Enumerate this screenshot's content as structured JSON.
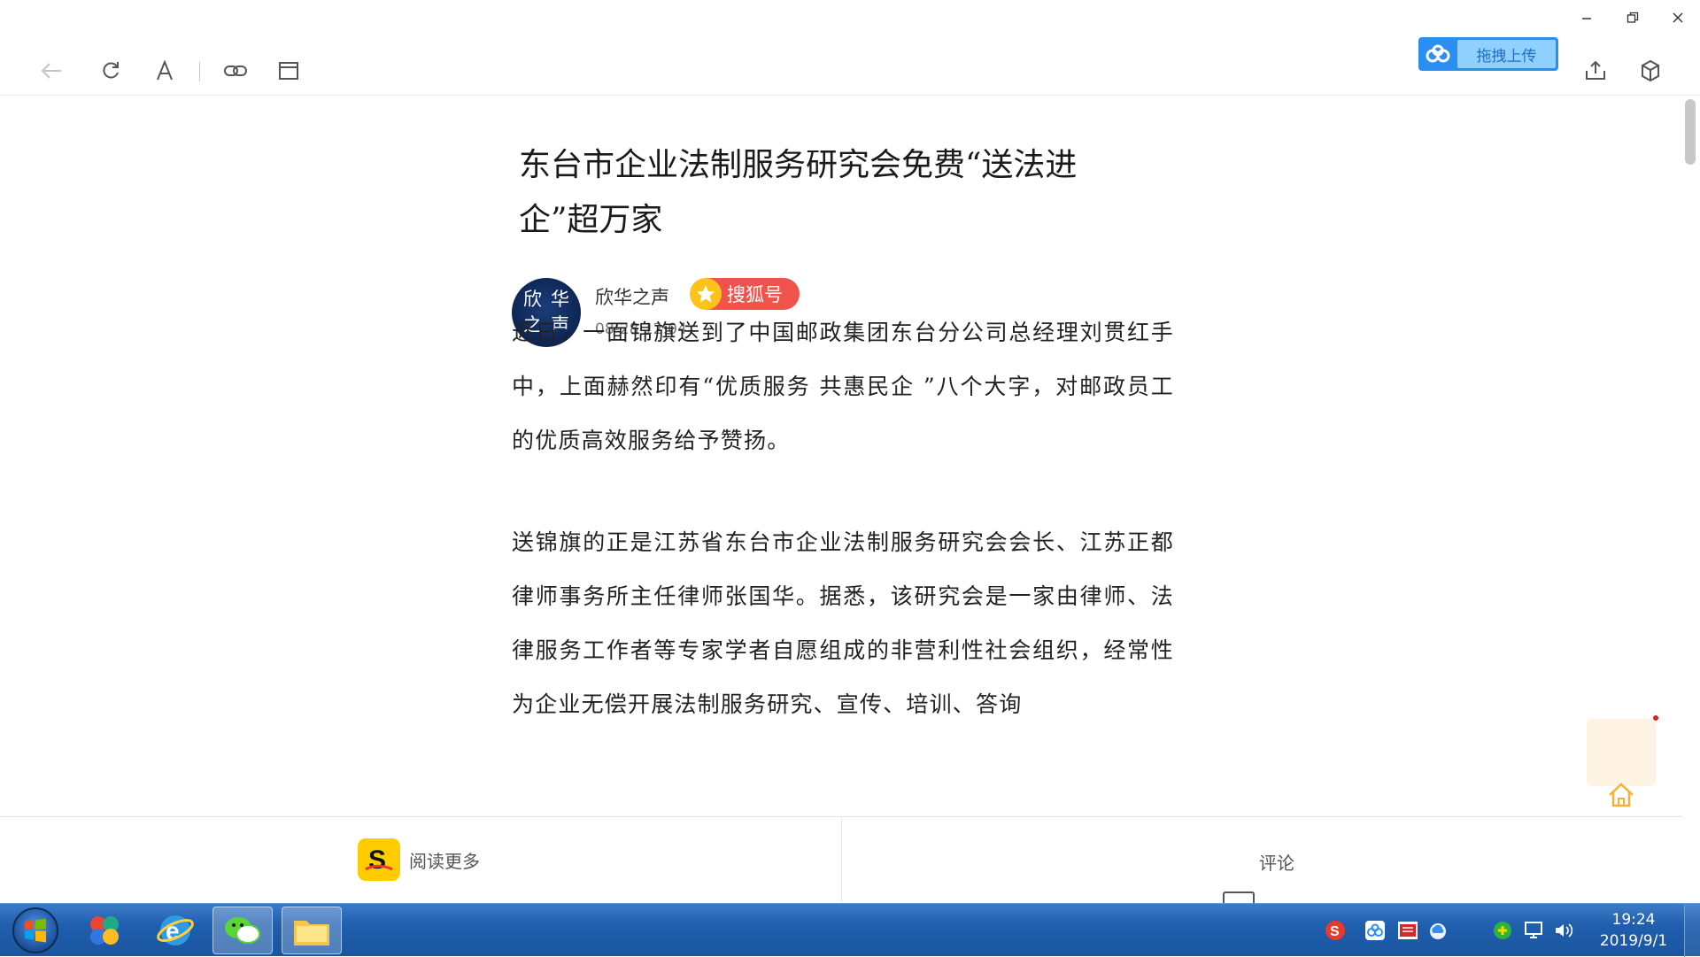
{
  "upload": {
    "label": "拖拽上传"
  },
  "article": {
    "title_line1": "东台市企业法制服务研究会免费“送法进",
    "title_line2": "企”超万家",
    "author": {
      "name": "欣华之声",
      "avatar_chars": [
        "欣",
        "华",
        "之",
        "声"
      ],
      "badge": "搜狐号",
      "time": "08-28 12:04"
    },
    "paragraphs": [
      "近日，一面锦旗送到了中国邮政集团东台分公司总经理刘贯红手中，上面赫然印有“优质服务 共惠民企 ”八个大字，对邮政员工的优质高效服务给予赞扬。",
      "送锦旗的正是江苏省东台市企业法制服务研究会会长、江苏正都律师事务所主任律师张国华。据悉，该研究会是一家由律师、法律服务工作者等专家学者自愿组成的非营利性社会组织，经常性为企业无偿开展法制服务研究、宣传、培训、答询"
    ]
  },
  "bottom_bar": {
    "read_more": "阅读更多",
    "comments": "评论"
  },
  "taskbar": {
    "time": "19:24",
    "date": "2019/9/1"
  },
  "colors": {
    "accent_blue": "#2b8ff2",
    "badge_red": "#f0534b",
    "taskbar": "#1f5fae"
  }
}
